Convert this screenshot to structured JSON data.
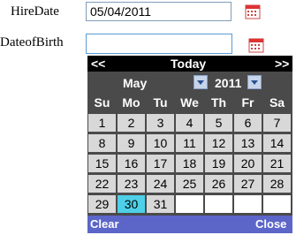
{
  "form": {
    "hire_date_label": "HireDate",
    "hire_date_value": "05/04/2011",
    "dob_label": "DateofBirth",
    "dob_value": ""
  },
  "calendar": {
    "prev_label": "<<",
    "today_label": "Today",
    "next_label": ">>",
    "month": "May",
    "year": "2011",
    "weekdays": [
      "Su",
      "Mo",
      "Tu",
      "We",
      "Th",
      "Fr",
      "Sa"
    ],
    "weeks": [
      [
        "1",
        "2",
        "3",
        "4",
        "5",
        "6",
        "7"
      ],
      [
        "8",
        "9",
        "10",
        "11",
        "12",
        "13",
        "14"
      ],
      [
        "15",
        "16",
        "17",
        "18",
        "19",
        "20",
        "21"
      ],
      [
        "22",
        "23",
        "24",
        "25",
        "26",
        "27",
        "28"
      ],
      [
        "29",
        "30",
        "31",
        "",
        "",
        "",
        ""
      ]
    ],
    "selected_day": "30",
    "clear_label": "Clear",
    "close_label": "Close"
  },
  "colors": {
    "header_bg": "#000000",
    "body_bg": "#4a4a4a",
    "day_bg": "#d8d8d8",
    "selected_bg": "#4dd0e8",
    "footer_bg": "#5b66c8"
  }
}
